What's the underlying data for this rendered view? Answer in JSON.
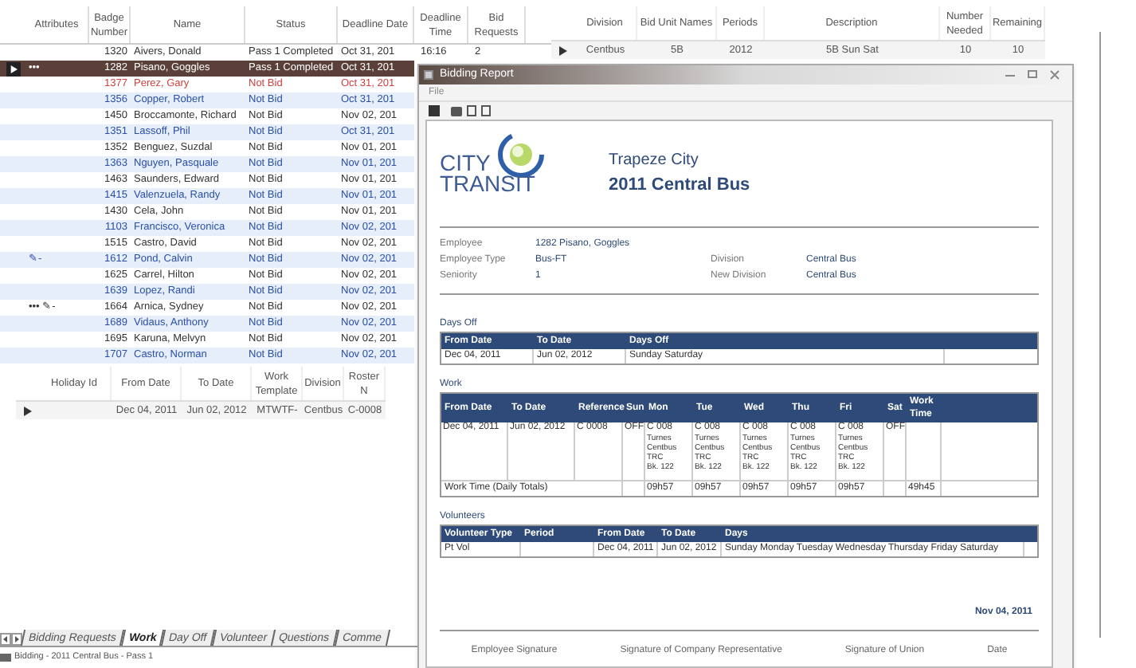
{
  "bid_grid": {
    "columns": [
      "Attributes",
      "Badge Number",
      "Name",
      "Status",
      "Deadline Date",
      "Deadline Time",
      "Bid Requests"
    ],
    "rows": [
      {
        "badge": "1320",
        "name": "Aivers, Donald",
        "status": "Pass 1 Completed",
        "date": "Oct 31, 201",
        "time": "16:16",
        "bids": "2",
        "color": "#333333",
        "selected": false
      },
      {
        "attributes": "•••",
        "badge": "1282",
        "name": "Pisano, Goggles",
        "status": "Pass 1 Completed",
        "date": "Oct 31, 201",
        "color": "#ffffff",
        "selected": true
      },
      {
        "badge": "1377",
        "name": "Perez, Gary",
        "status": "Not Bid",
        "date": "Oct 31, 201",
        "color": "#d04040",
        "selected": false
      },
      {
        "badge": "1356",
        "name": "Copper, Robert",
        "status": "Not Bid",
        "date": "Oct 31, 201",
        "color": "#2a4fa8",
        "selected": false
      },
      {
        "badge": "1450",
        "name": "Broccamonte, Richard",
        "status": "Not Bid",
        "date": "Nov 02, 201",
        "color": "#333333",
        "selected": false
      },
      {
        "badge": "1351",
        "name": "Lassoff, Phil",
        "status": "Not Bid",
        "date": "Oct 31, 201",
        "color": "#2a4fa8",
        "selected": false
      },
      {
        "badge": "1352",
        "name": "Benguez, Suzdal",
        "status": "Not Bid",
        "date": "Nov 01, 201",
        "color": "#333333",
        "selected": false
      },
      {
        "badge": "1363",
        "name": "Nguyen, Pasquale",
        "status": "Not Bid",
        "date": "Nov 01, 201",
        "color": "#2a4fa8",
        "selected": false
      },
      {
        "badge": "1463",
        "name": "Saunders, Edward",
        "status": "Not Bid",
        "date": "Nov 01, 201",
        "color": "#333333",
        "selected": false
      },
      {
        "badge": "1415",
        "name": "Valenzuela, Randy",
        "status": "Not Bid",
        "date": "Nov 01, 201",
        "color": "#2a4fa8",
        "selected": false
      },
      {
        "badge": "1430",
        "name": "Cela, John",
        "status": "Not Bid",
        "date": "Nov 01, 201",
        "color": "#333333",
        "selected": false
      },
      {
        "badge": "1103",
        "name": "Francisco, Veronica",
        "status": "Not Bid",
        "date": "Nov 02, 201",
        "color": "#2a4fa8",
        "selected": false
      },
      {
        "badge": "1515",
        "name": "Castro, David",
        "status": "Not Bid",
        "date": "Nov 02, 201",
        "color": "#333333",
        "selected": false
      },
      {
        "attributes": "✎-",
        "badge": "1612",
        "name": "Pond, Calvin",
        "status": "Not Bid",
        "date": "Nov 02, 201",
        "color": "#2a4fa8",
        "selected": false
      },
      {
        "badge": "1625",
        "name": "Carrel, Hilton",
        "status": "Not Bid",
        "date": "Nov 02, 201",
        "color": "#333333",
        "selected": false
      },
      {
        "badge": "1639",
        "name": "Lopez, Randi",
        "status": "Not Bid",
        "date": "Nov 02, 201",
        "color": "#2a4fa8",
        "selected": false
      },
      {
        "attributes": "••• ✎-",
        "badge": "1664",
        "name": "Arnica, Sydney",
        "status": "Not Bid",
        "date": "Nov 02, 201",
        "color": "#333333",
        "selected": false
      },
      {
        "badge": "1689",
        "name": "Vidaus, Anthony",
        "status": "Not Bid",
        "date": "Nov 02, 201",
        "color": "#2a4fa8",
        "selected": false
      },
      {
        "badge": "1695",
        "name": "Karuna, Melvyn",
        "status": "Not Bid",
        "date": "Nov 02, 201",
        "color": "#333333",
        "selected": false
      },
      {
        "badge": "1707",
        "name": "Castro, Norman",
        "status": "Not Bid",
        "date": "Nov 02, 201",
        "color": "#2a4fa8",
        "selected": false
      }
    ]
  },
  "unit_grid": {
    "columns": [
      "Division",
      "Bid Unit Names",
      "Periods",
      "Description",
      "Number Needed",
      "Remaining"
    ],
    "rows": [
      {
        "cells": [
          "Centbus",
          "5B",
          "2012",
          "5B Sun Sat",
          "10",
          "10"
        ],
        "selected": true
      }
    ]
  },
  "holiday_grid": {
    "columns": [
      "Holiday Id",
      "From Date",
      "To Date",
      "Work Template",
      "Division",
      "Roster N"
    ],
    "rows": [
      {
        "cells": [
          null,
          "Dec 04, 2011",
          "Jun 02, 2012",
          "MTWTF-",
          "Centbus",
          "C-0008"
        ],
        "selected": true
      }
    ]
  },
  "sheet_tabs": [
    {
      "label": "Bidding Requests",
      "selected": false
    },
    {
      "label": "Work",
      "selected": true
    },
    {
      "label": "Day Off",
      "selected": false
    },
    {
      "label": "Volunteer",
      "selected": false
    },
    {
      "label": "Questions",
      "selected": false
    },
    {
      "label": "Comme",
      "selected": false
    }
  ],
  "status_bar": "Bidding - 2011 Central Bus - Pass 1",
  "dialog": {
    "title": "Bidding Report",
    "menu": [
      "File"
    ],
    "report": {
      "logo": [
        "CITY",
        "TRANSIT"
      ],
      "company": "Trapeze City",
      "bid_name": "2011 Central Bus",
      "fields": [
        {
          "label": "Employee",
          "value": "1282 Pisano, Goggles"
        },
        {
          "label": "Employee Type",
          "value": "Bus-FT",
          "label2": "Division",
          "value2": "Central Bus"
        },
        {
          "label": "Seniority",
          "value": "1",
          "label2": "New Division",
          "value2": "Central Bus"
        }
      ],
      "days_off": {
        "title": "Days Off",
        "columns": [
          "From Date",
          "To Date",
          "Days Off"
        ],
        "rows": [
          [
            "Dec 04, 2011",
            "Jun 02, 2012",
            "Sunday Saturday"
          ]
        ]
      },
      "work": {
        "title": "Work",
        "columns": [
          "From Date",
          "To Date",
          "Reference",
          "Sun",
          "Mon",
          "Tue",
          "Wed",
          "Thu",
          "Fri",
          "Sat",
          "Work Time"
        ],
        "row": [
          [
            "Dec 04, 2011"
          ],
          [
            "Jun 02, 2012"
          ],
          [
            "C 0008"
          ],
          [
            "OFF"
          ],
          [
            "C 008",
            "Turnes",
            "Centbus TRC",
            "Bk. 122"
          ],
          [
            "C 008",
            "Turnes",
            "Centbus TRC",
            "Bk. 122"
          ],
          [
            "C 008",
            "Turnes",
            "Centbus TRC",
            "Bk. 122"
          ],
          [
            "C 008",
            "Turnes",
            "Centbus TRC",
            "Bk. 122"
          ],
          [
            "C 008",
            "Turnes",
            "Centbus TRC",
            "Bk. 122"
          ],
          [
            "OFF"
          ]
        ],
        "totals_label": "Work Time (Daily Totals)",
        "totals": [
          "09h57",
          "09h57",
          "09h57",
          "09h57",
          "09h57"
        ],
        "total": "49h45"
      },
      "volunteers": {
        "title": "Volunteers",
        "columns": [
          "Volunteer Type",
          "Period",
          "From Date",
          "To Date",
          "Days"
        ],
        "rows": [
          [
            "Pt Vol",
            null,
            "Dec 04, 2011",
            "Jun 02, 2012",
            "Sunday Monday Tuesday Wednesday Thursday Friday Saturday"
          ]
        ]
      },
      "print_date": "Nov 04, 2011",
      "signatures": [
        "Employee Signature",
        "Signature of Company Representative",
        "Signature of Union",
        "Date"
      ]
    }
  }
}
